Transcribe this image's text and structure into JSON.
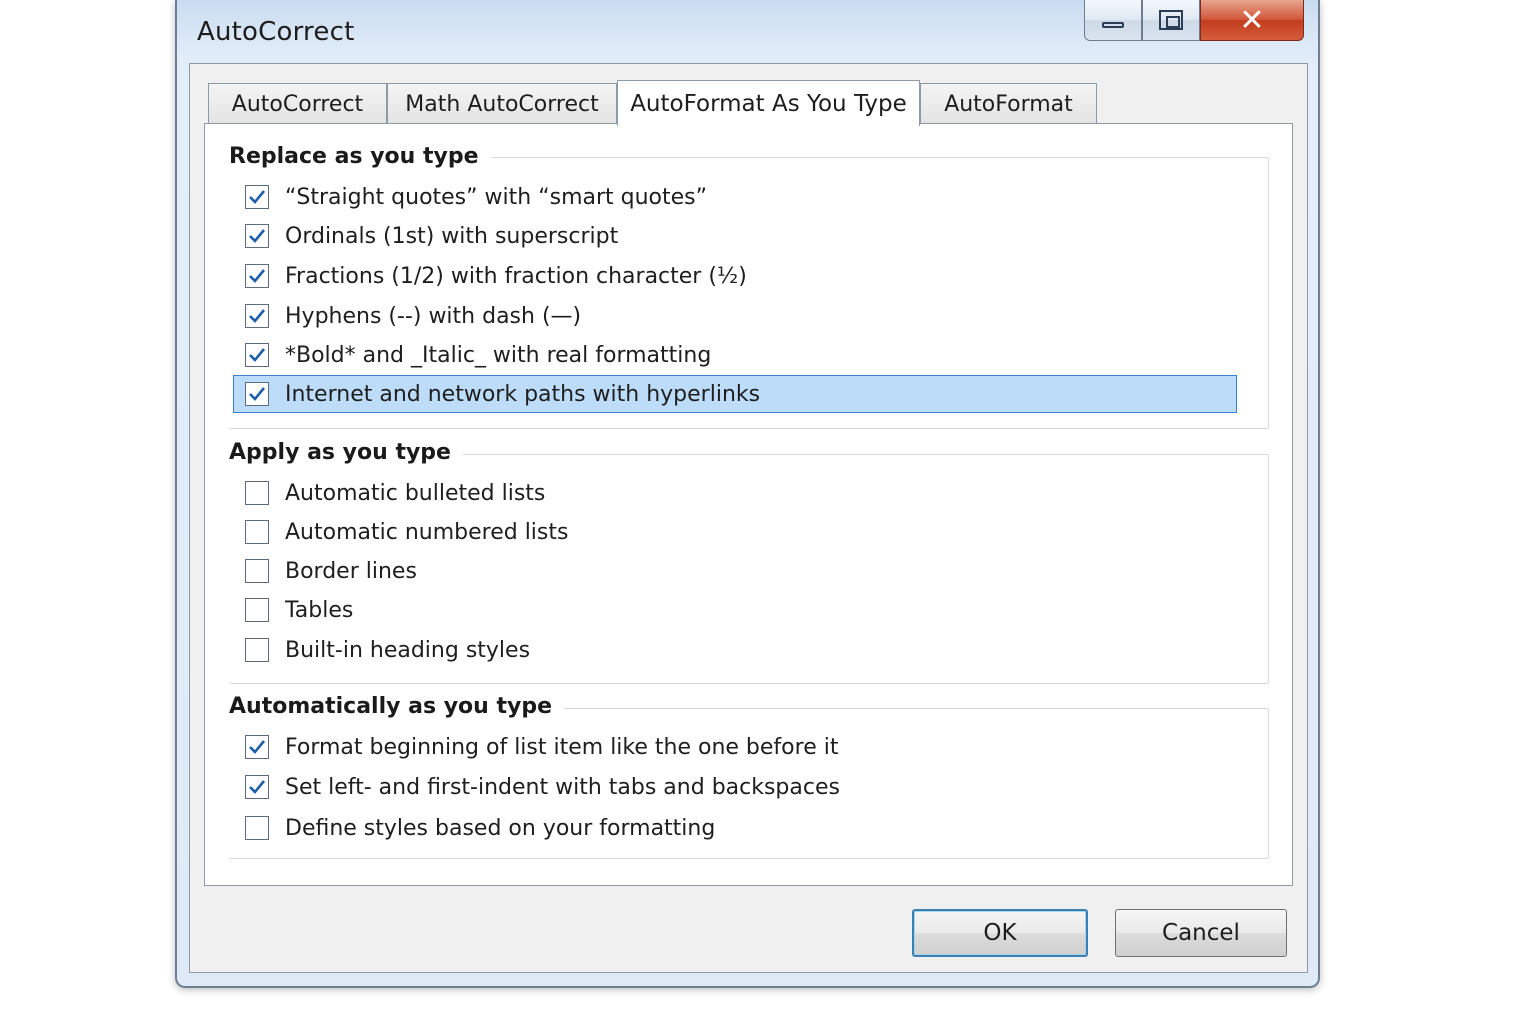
{
  "window": {
    "title": "AutoCorrect"
  },
  "tabs": [
    {
      "label": "AutoCorrect",
      "active": false
    },
    {
      "label": "Math AutoCorrect",
      "active": false
    },
    {
      "label": "AutoFormat As You Type",
      "active": true
    },
    {
      "label": "AutoFormat",
      "active": false
    }
  ],
  "groups": {
    "replace": {
      "title": "Replace as you type",
      "options": [
        {
          "label": "“Straight quotes” with “smart quotes”",
          "checked": true
        },
        {
          "label": "Ordinals (1st) with superscript",
          "checked": true
        },
        {
          "label": "Fractions (1/2) with fraction character (½)",
          "checked": true
        },
        {
          "label": "Hyphens (--) with dash (—)",
          "checked": true
        },
        {
          "label": "*Bold* and _Italic_ with real formatting",
          "checked": true
        },
        {
          "label": "Internet and network paths with hyperlinks",
          "checked": true,
          "selected": true
        }
      ]
    },
    "apply": {
      "title": "Apply as you type",
      "options": [
        {
          "label": "Automatic bulleted lists",
          "checked": false
        },
        {
          "label": "Automatic numbered lists",
          "checked": false
        },
        {
          "label": "Border lines",
          "checked": false
        },
        {
          "label": "Tables",
          "checked": false
        },
        {
          "label": "Built-in heading styles",
          "checked": false
        }
      ]
    },
    "auto": {
      "title": "Automatically as you type",
      "options": [
        {
          "label": "Format beginning of list item like the one before it",
          "checked": true
        },
        {
          "label": "Set left- and first-indent with tabs and backspaces",
          "checked": true
        },
        {
          "label": "Define styles based on your formatting",
          "checked": false
        }
      ]
    }
  },
  "buttons": {
    "ok": "OK",
    "cancel": "Cancel"
  },
  "colors": {
    "selection_fill": "#bcdcfa",
    "selection_border": "#3b7fd0",
    "checkmark": "#1f5fa8",
    "close_button": "#c9452a"
  }
}
